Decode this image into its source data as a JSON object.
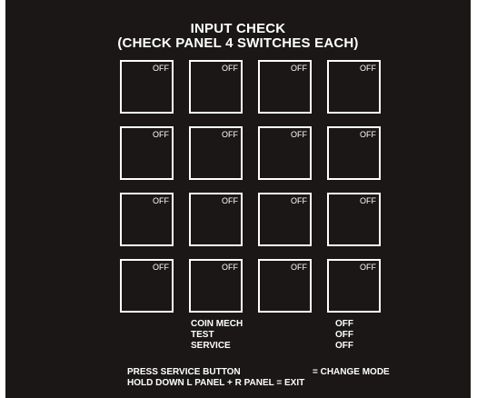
{
  "title_line1": "INPUT CHECK",
  "title_line2": "(CHECK PANEL 4 SWITCHES EACH)",
  "switches": [
    "OFF",
    "OFF",
    "OFF",
    "OFF",
    "OFF",
    "OFF",
    "OFF",
    "OFF",
    "OFF",
    "OFF",
    "OFF",
    "OFF",
    "OFF",
    "OFF",
    "OFF",
    "OFF"
  ],
  "status": [
    {
      "label": "COIN MECH",
      "value": "OFF"
    },
    {
      "label": "TEST",
      "value": "OFF"
    },
    {
      "label": "SERVICE",
      "value": "OFF"
    }
  ],
  "footer": {
    "line1_left": "PRESS SERVICE BUTTON",
    "line1_right": "= CHANGE MODE",
    "line2": "HOLD DOWN L PANEL + R PANEL = EXIT"
  },
  "colors": {
    "background": "#1a1716",
    "foreground": "#ffffff"
  }
}
